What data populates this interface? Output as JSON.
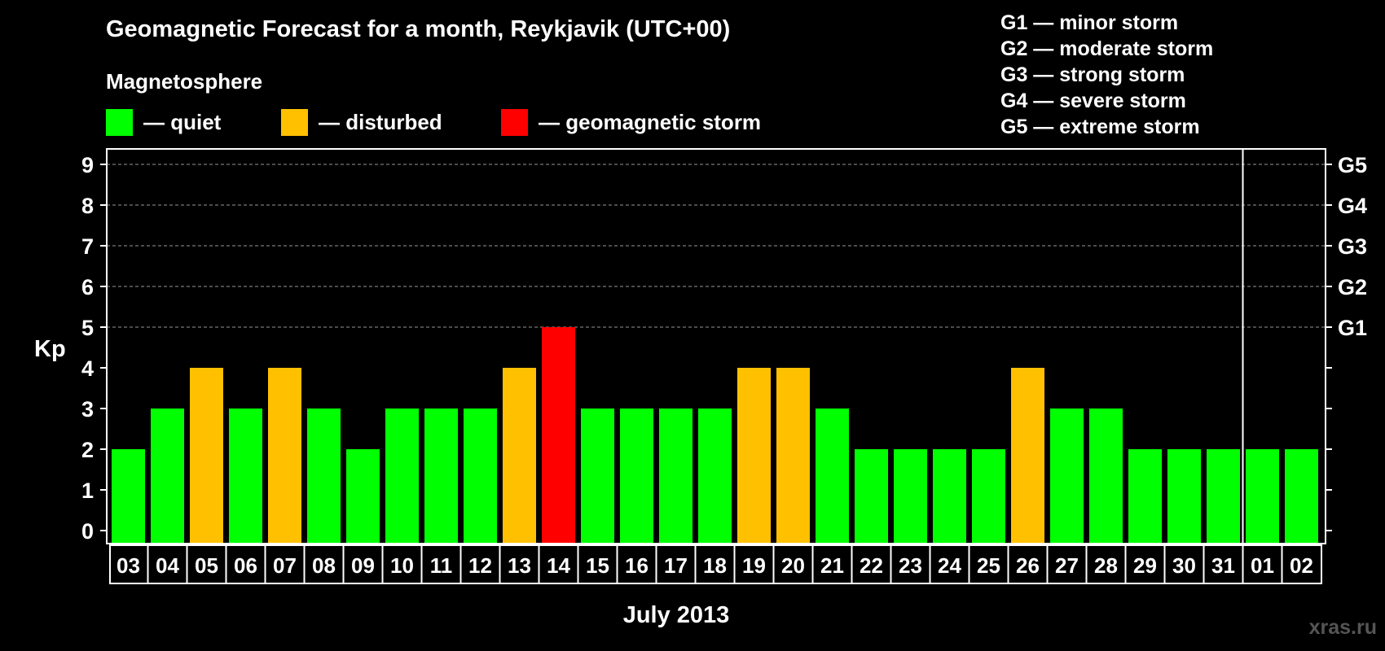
{
  "title": "Geomagnetic Forecast for a month, Reykjavik (UTC+00)",
  "legend": {
    "heading": "Magnetosphere",
    "items": [
      {
        "label": "— quiet",
        "color": "#00ff00"
      },
      {
        "label": "— disturbed",
        "color": "#ffc000"
      },
      {
        "label": "— geomagnetic storm",
        "color": "#ff0000"
      }
    ]
  },
  "g_scale": [
    "G1 — minor storm",
    "G2 — moderate storm",
    "G3 — strong storm",
    "G4 — severe storm",
    "G5 — extreme storm"
  ],
  "watermark": "xras.ru",
  "chart_data": {
    "type": "bar",
    "ylabel": "Kp",
    "xlabel": "July 2013",
    "ylim": [
      0,
      9
    ],
    "yticks": [
      0,
      1,
      2,
      3,
      4,
      5,
      6,
      7,
      8,
      9
    ],
    "right_axis_labels": [
      {
        "y": 5,
        "label": "G1"
      },
      {
        "y": 6,
        "label": "G2"
      },
      {
        "y": 7,
        "label": "G3"
      },
      {
        "y": 8,
        "label": "G4"
      },
      {
        "y": 9,
        "label": "G5"
      }
    ],
    "grid_dashed_at": [
      5,
      6,
      7,
      8,
      9
    ],
    "month_separator_before": "01",
    "categories": [
      "03",
      "04",
      "05",
      "06",
      "07",
      "08",
      "09",
      "10",
      "11",
      "12",
      "13",
      "14",
      "15",
      "16",
      "17",
      "18",
      "19",
      "20",
      "21",
      "22",
      "23",
      "24",
      "25",
      "26",
      "27",
      "28",
      "29",
      "30",
      "31",
      "01",
      "02"
    ],
    "values": [
      2,
      3,
      4,
      3,
      4,
      3,
      2,
      3,
      3,
      3,
      4,
      5,
      3,
      3,
      3,
      3,
      4,
      4,
      3,
      2,
      2,
      2,
      2,
      4,
      3,
      3,
      2,
      2,
      2,
      2,
      2
    ],
    "colors": {
      "quiet": "#00ff00",
      "disturbed": "#ffc000",
      "storm": "#ff0000"
    }
  }
}
